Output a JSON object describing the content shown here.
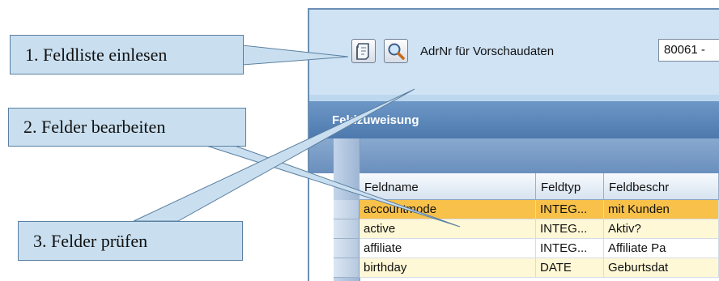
{
  "callouts": {
    "step1": "1. Feldliste einlesen",
    "step2": "2. Felder bearbeiten",
    "step3": "3. Felder prüfen"
  },
  "toolbar": {
    "read_fieldlist_icon": "document-icon",
    "search_icon": "magnifier-icon",
    "preview_label": "AdrNr für Vorschaudaten",
    "adr_value": "80061 -"
  },
  "section": {
    "title": "Feldzuweisung"
  },
  "grid": {
    "columns": [
      "Feldname",
      "Feldtyp",
      "Feldbeschr"
    ],
    "rows": [
      {
        "name": "accountmode",
        "type": "INTEG...",
        "desc": "mit Kunden"
      },
      {
        "name": "active",
        "type": "INTEG...",
        "desc": "Aktiv?"
      },
      {
        "name": "affiliate",
        "type": "INTEG...",
        "desc": "Affiliate Pa"
      },
      {
        "name": "birthday",
        "type": "DATE",
        "desc": "Geburtsdat"
      }
    ]
  },
  "colors": {
    "selected_row": "#f7c14a",
    "alt_row": "#fff8d6",
    "header": "#5a84b8"
  }
}
